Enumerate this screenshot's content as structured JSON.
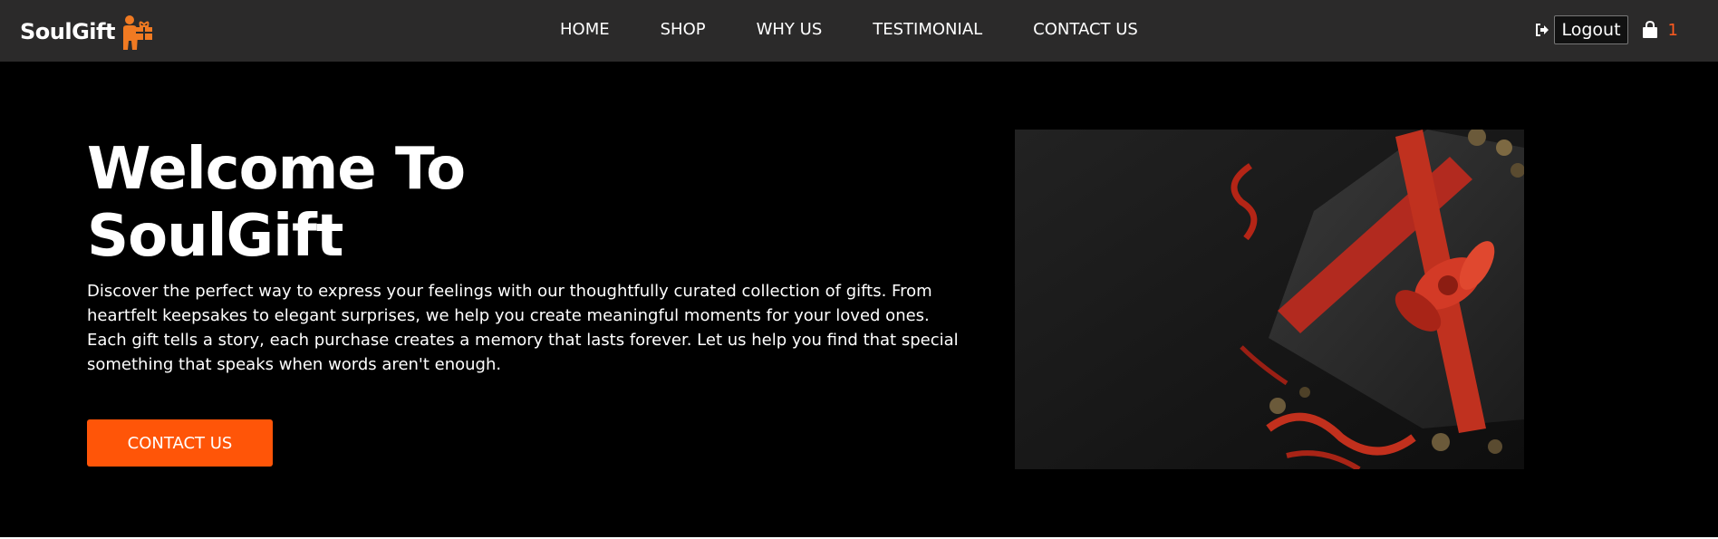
{
  "brand": {
    "name": "SoulGift",
    "logo_icon": "person-gift-logo",
    "accent": "#f07a22"
  },
  "nav": {
    "items": [
      {
        "label": "HOME"
      },
      {
        "label": "SHOP"
      },
      {
        "label": "WHY US"
      },
      {
        "label": "TESTIMONIAL"
      },
      {
        "label": "CONTACT US"
      }
    ]
  },
  "account": {
    "logout_label": "Logout",
    "logout_icon": "sign-out-icon",
    "cart_icon": "shopping-bag-icon",
    "cart_count": "1"
  },
  "hero": {
    "title": "Welcome To SoulGift",
    "description": "Discover the perfect way to express your feelings with our thoughtfully curated collection of gifts. From heartfelt keepsakes to elegant surprises, we help you create meaningful moments for your loved ones. Each gift tells a story, each purchase creates a memory that lasts forever. Let us help you find that special something that speaks when words aren't enough.",
    "cta_label": "CONTACT US",
    "cta_color": "#ff5508",
    "image_icon": "gift-box-photo"
  }
}
